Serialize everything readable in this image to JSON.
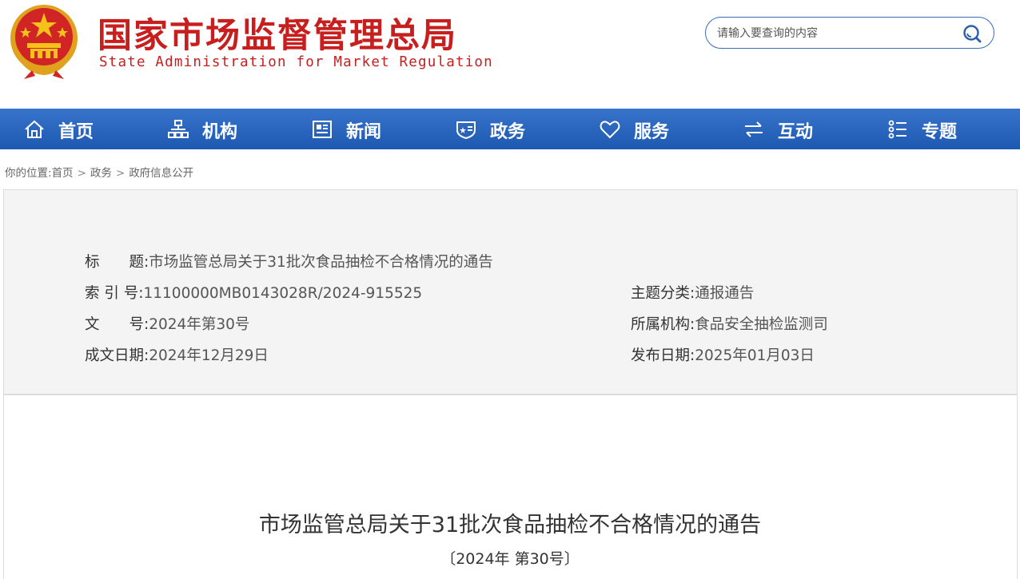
{
  "header": {
    "logo_cn": "国家市场监督管理总局",
    "logo_en": "State Administration for Market Regulation",
    "search": {
      "placeholder": "请输入要查询的内容"
    }
  },
  "nav": {
    "items": [
      {
        "label": "首页",
        "icon": "home-icon"
      },
      {
        "label": "机构",
        "icon": "org-chart-icon"
      },
      {
        "label": "新闻",
        "icon": "newspaper-icon"
      },
      {
        "label": "政务",
        "icon": "shield-star-icon"
      },
      {
        "label": "服务",
        "icon": "heart-icon"
      },
      {
        "label": "互动",
        "icon": "exchange-arrows-icon"
      },
      {
        "label": "专题",
        "icon": "list-icon"
      }
    ]
  },
  "breadcrumb": {
    "prefix": "你的位置:",
    "items": [
      "首页",
      "政务",
      "政府信息公开"
    ],
    "separator": ">"
  },
  "meta": {
    "title_label": "标　　题:",
    "title_value": "市场监管总局关于31批次食品抽检不合格情况的通告",
    "index_label": "索 引 号:",
    "index_value": "11100000MB0143028R/2024-915525",
    "category_label": "主题分类:",
    "category_value": "通报通告",
    "docno_label": "文　　号:",
    "docno_value": "2024年第30号",
    "agency_label": "所属机构:",
    "agency_value": "食品安全抽检监测司",
    "written_label": "成文日期:",
    "written_value": "2024年12月29日",
    "publish_label": "发布日期:",
    "publish_value": "2025年01月03日"
  },
  "document": {
    "title": "市场监管总局关于31批次食品抽检不合格情况的通告",
    "number": "〔2024年 第30号〕"
  },
  "colors": {
    "brand_red": "#c81e1e",
    "nav_blue": "#2563c0",
    "search_border": "#3a6bb8",
    "info_bg": "#f4f4f4"
  }
}
